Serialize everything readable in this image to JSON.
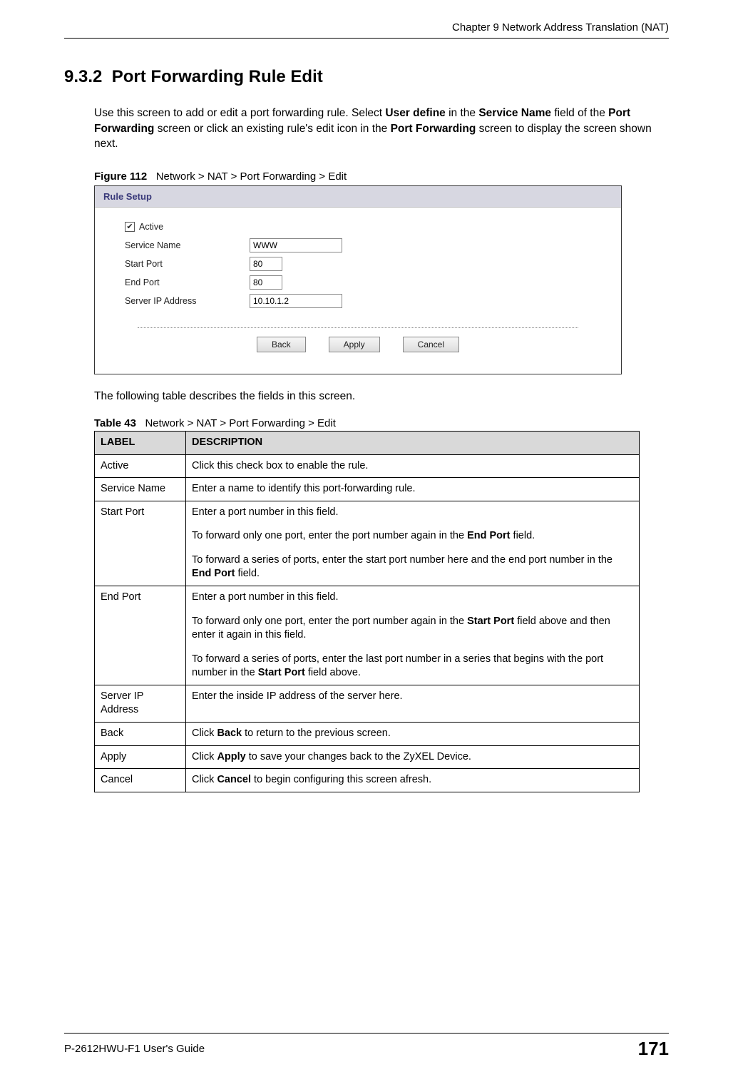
{
  "header": {
    "chapter": "Chapter 9 Network Address Translation (NAT)"
  },
  "section": {
    "number": "9.3.2",
    "title": "Port Forwarding Rule Edit"
  },
  "intro": {
    "t1": "Use this screen to add or edit a port forwarding rule. Select ",
    "b1": "User define",
    "t2": " in the ",
    "b2": "Service Name",
    "t3": " field of the ",
    "b3": "Port Forwarding",
    "t4": " screen or click an existing rule's edit icon in the ",
    "b4": "Port Forwarding",
    "t5": " screen to display the screen shown next."
  },
  "figure": {
    "label": "Figure 112",
    "caption": "Network > NAT > Port Forwarding > Edit"
  },
  "rule_setup": {
    "title": "Rule Setup",
    "active_checked": "✔",
    "active_label": "Active",
    "service_label": "Service Name",
    "service_value": "WWW",
    "start_label": "Start Port",
    "start_value": "80",
    "end_label": "End Port",
    "end_value": "80",
    "ip_label": "Server IP Address",
    "ip_value": "10.10.1.2",
    "btn_back": "Back",
    "btn_apply": "Apply",
    "btn_cancel": "Cancel"
  },
  "para2": "The following table describes the fields in this screen.",
  "table_caption": {
    "label": "Table 43",
    "text": "Network > NAT > Port Forwarding > Edit"
  },
  "table": {
    "head_label": "LABEL",
    "head_desc": "DESCRIPTION",
    "rows": {
      "active_l": "Active",
      "active_d": "Click this check box to enable the rule.",
      "svc_l": "Service Name",
      "svc_d": "Enter a name to identify this port-forwarding rule.",
      "sp_l": "Start Port",
      "sp_d1": "Enter a port number in this field.",
      "sp_d2a": "To forward only one port, enter the port number again in the ",
      "sp_d2b": "End Port",
      "sp_d2c": " field.",
      "sp_d3a": "To forward a series of ports, enter the start port number here and the end port number in the ",
      "sp_d3b": "End Port",
      "sp_d3c": " field.",
      "ep_l": "End Port",
      "ep_d1": "Enter a port number in this field.",
      "ep_d2a": "To forward only one port, enter the port number again in the ",
      "ep_d2b": "Start Port",
      "ep_d2c": " field above and then enter it again in this field.",
      "ep_d3a": "To forward a series of ports, enter the last port number in a series that begins with the port number in the ",
      "ep_d3b": "Start Port",
      "ep_d3c": " field above.",
      "ip_l": "Server IP Address",
      "ip_d": "Enter the inside IP address of the server here.",
      "back_l": "Back",
      "back_d1": "Click ",
      "back_d2": "Back",
      "back_d3": " to return to the previous screen.",
      "apply_l": "Apply",
      "apply_d1": "Click ",
      "apply_d2": "Apply",
      "apply_d3": " to save your changes back to the ZyXEL Device.",
      "cancel_l": "Cancel",
      "cancel_d1": "Click ",
      "cancel_d2": "Cancel",
      "cancel_d3": " to begin configuring this screen afresh."
    }
  },
  "footer": {
    "guide": "P-2612HWU-F1 User's Guide",
    "page": "171"
  }
}
